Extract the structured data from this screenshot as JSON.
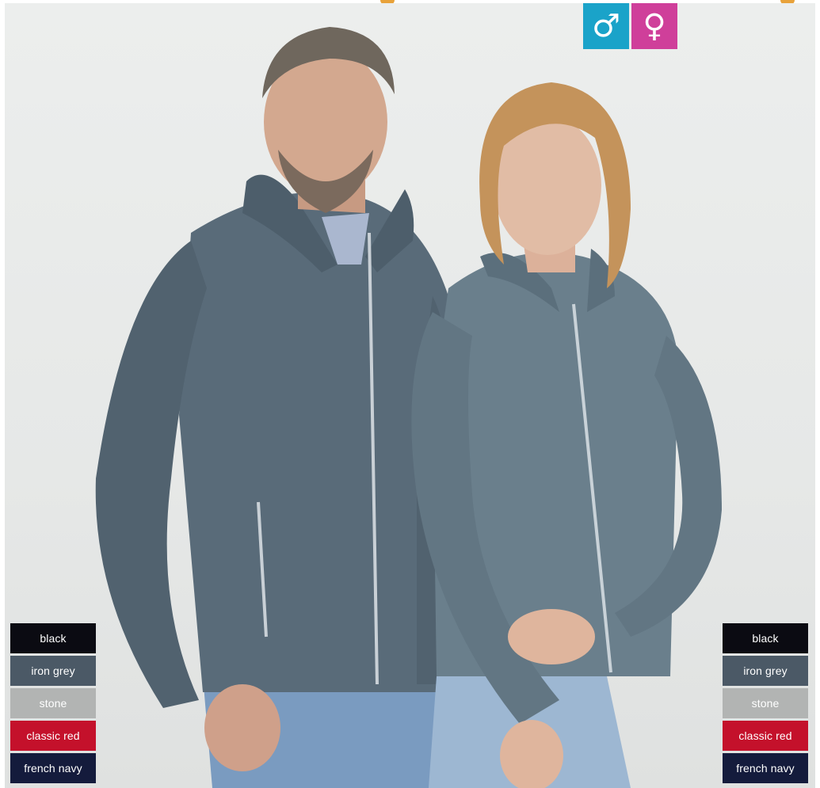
{
  "gender_badges": [
    {
      "name": "male",
      "symbol": "♂",
      "color": "#1aa3c9"
    },
    {
      "name": "female",
      "symbol": "♀",
      "color": "#cf3f9a"
    }
  ],
  "swatches_left": [
    {
      "label": "black",
      "color": "#0b0b12"
    },
    {
      "label": "iron grey",
      "color": "#4b5966"
    },
    {
      "label": "stone",
      "color": "#b2b4b3"
    },
    {
      "label": "classic red",
      "color": "#c4112b"
    },
    {
      "label": "french navy",
      "color": "#141b3c"
    }
  ],
  "swatches_right": [
    {
      "label": "black",
      "color": "#0b0b12"
    },
    {
      "label": "iron grey",
      "color": "#4b5966"
    },
    {
      "label": "stone",
      "color": "#b2b4b3"
    },
    {
      "label": "classic red",
      "color": "#c4112b"
    },
    {
      "label": "french navy",
      "color": "#141b3c"
    }
  ],
  "accent_color": "#e8a23a"
}
